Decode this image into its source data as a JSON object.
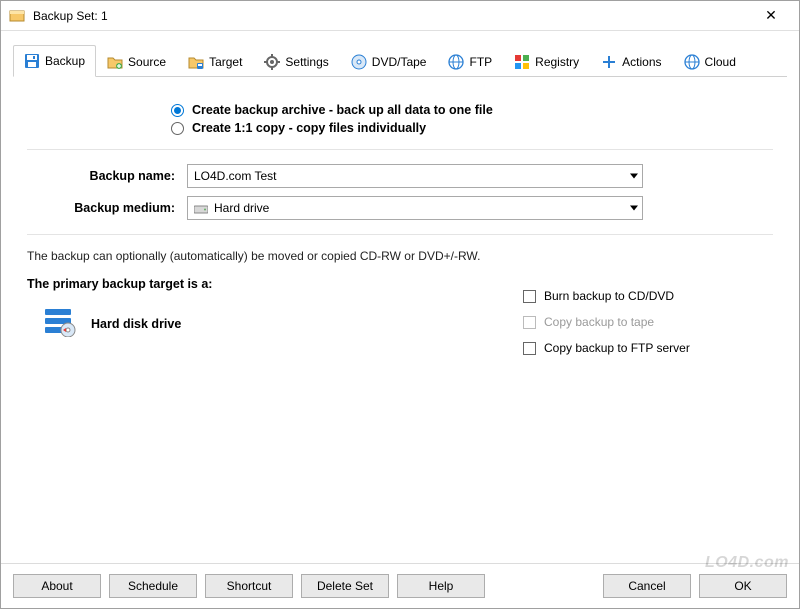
{
  "window": {
    "title": "Backup Set: 1"
  },
  "tabs": {
    "backup": "Backup",
    "source": "Source",
    "target": "Target",
    "settings": "Settings",
    "dvdtape": "DVD/Tape",
    "ftp": "FTP",
    "registry": "Registry",
    "actions": "Actions",
    "cloud": "Cloud"
  },
  "radios": {
    "archive": "Create backup archive - back up all data to one file",
    "copy": "Create 1:1 copy - copy files individually"
  },
  "form": {
    "name_label": "Backup name:",
    "name_value": "LO4D.com Test",
    "medium_label": "Backup medium:",
    "medium_value": "Hard drive"
  },
  "note": "The backup can optionally (automatically) be moved or copied CD-RW or DVD+/-RW.",
  "primary": {
    "label": "The primary backup target is a:",
    "value": "Hard disk drive"
  },
  "options": {
    "burn": "Burn backup to CD/DVD",
    "tape": "Copy backup to tape",
    "ftp": "Copy backup to FTP server"
  },
  "buttons": {
    "about": "About",
    "schedule": "Schedule",
    "shortcut": "Shortcut",
    "deleteset": "Delete Set",
    "help": "Help",
    "cancel": "Cancel",
    "ok": "OK"
  },
  "watermark": "LO4D.com"
}
